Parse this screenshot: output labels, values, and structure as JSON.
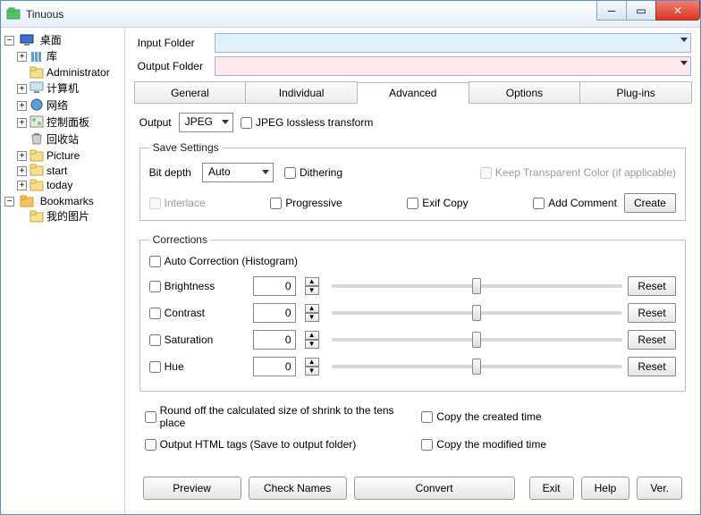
{
  "window": {
    "title": "Tinuous"
  },
  "tree": {
    "desktop": "桌面",
    "items": [
      {
        "label": "库",
        "expandable": true
      },
      {
        "label": "Administrator",
        "expandable": false
      },
      {
        "label": "计算机",
        "expandable": true
      },
      {
        "label": "网络",
        "expandable": true
      },
      {
        "label": "控制面板",
        "expandable": true
      },
      {
        "label": "回收站",
        "expandable": false
      },
      {
        "label": "Picture",
        "expandable": true
      },
      {
        "label": "start",
        "expandable": true
      },
      {
        "label": "today",
        "expandable": true
      }
    ],
    "bookmarks": "Bookmarks",
    "bookmarks_items": [
      {
        "label": "我的图片"
      }
    ]
  },
  "folders": {
    "input_label": "Input Folder",
    "input_value": "",
    "output_label": "Output Folder",
    "output_value": ""
  },
  "tabs": {
    "general": "General",
    "individual": "Individual",
    "advanced": "Advanced",
    "options": "Options",
    "plugins": "Plug-ins",
    "active": "advanced"
  },
  "output": {
    "label": "Output",
    "format": "JPEG",
    "lossless": "JPEG lossless transform"
  },
  "save_settings": {
    "legend": "Save Settings",
    "bit_depth_label": "Bit depth",
    "bit_depth_value": "Auto",
    "dithering": "Dithering",
    "keep_transparent": "Keep Transparent Color (if applicable)",
    "interlace": "Interlace",
    "progressive": "Progressive",
    "exif_copy": "Exif Copy",
    "add_comment": "Add Comment",
    "create_btn": "Create"
  },
  "corrections": {
    "legend": "Corrections",
    "auto": "Auto Correction (Histogram)",
    "reset": "Reset",
    "rows": [
      {
        "label": "Brightness",
        "value": 0
      },
      {
        "label": "Contrast",
        "value": 0
      },
      {
        "label": "Saturation",
        "value": 0
      },
      {
        "label": "Hue",
        "value": 0
      }
    ]
  },
  "bottom": {
    "round_off": "Round off the calculated size of shrink to the tens place",
    "copy_created": "Copy the created time",
    "output_html": "Output HTML tags (Save to output folder)",
    "copy_modified": "Copy the modified time"
  },
  "footer": {
    "preview": "Preview",
    "check_names": "Check Names",
    "convert": "Convert",
    "exit": "Exit",
    "help": "Help",
    "ver": "Ver."
  }
}
